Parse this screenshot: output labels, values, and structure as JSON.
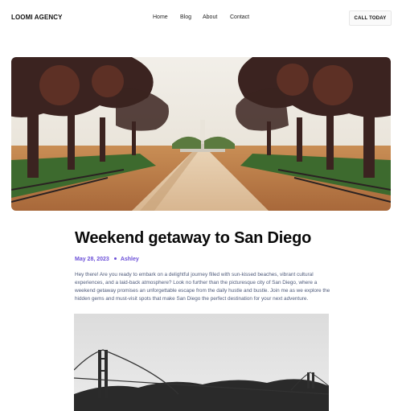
{
  "header": {
    "brand": "LOOMI AGENCY",
    "nav": [
      "Home",
      "Blog",
      "About",
      "Contact"
    ],
    "cta": "CALL TODAY"
  },
  "post": {
    "title": "Weekend getaway to San Diego",
    "date": "May 28, 2023",
    "author": "Ashley",
    "intro": "Hey there! Are you ready to embark on a delightful journey filled with sun-kissed beaches, vibrant cultural experiences, and a laid-back atmosphere? Look no further than the picturesque city of San Diego, where a weekend getaway promises an unforgettable escape from the daily hustle and bustle. Join me as we explore the hidden gems and must-visit spots that make San Diego the perfect destination for your next adventure."
  },
  "colors": {
    "accent": "#6b4fd8",
    "body_text": "#4e5a7a"
  }
}
